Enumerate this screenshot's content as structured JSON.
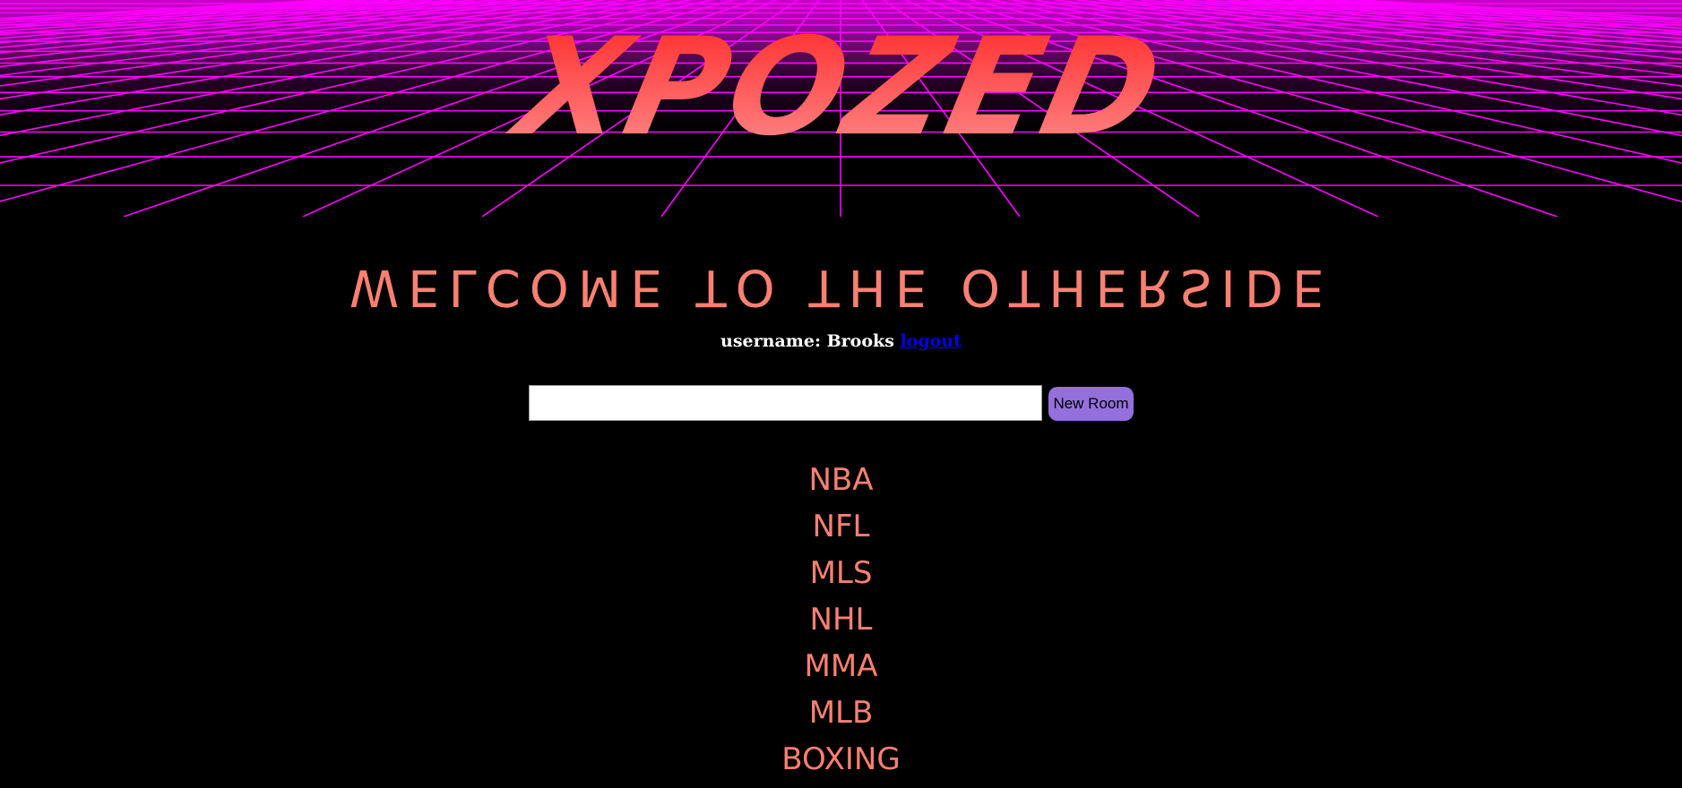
{
  "header": {
    "logo_text": "XPOZED"
  },
  "welcome": {
    "text": "WELCOME TO THE OTHERSIDE"
  },
  "user": {
    "label": "username:",
    "name": "Brooks",
    "logout_label": "logout"
  },
  "new_room": {
    "input_value": "",
    "button_label": "New Room"
  },
  "rooms": [
    "NBA",
    "NFL",
    "MLS",
    "NHL",
    "MMA",
    "MLB",
    "BOXING"
  ],
  "colors": {
    "background": "#000000",
    "grid": "#ff00ff",
    "salmon_text": "#fa8072",
    "button": "#9370db",
    "link": "#0000ee"
  }
}
